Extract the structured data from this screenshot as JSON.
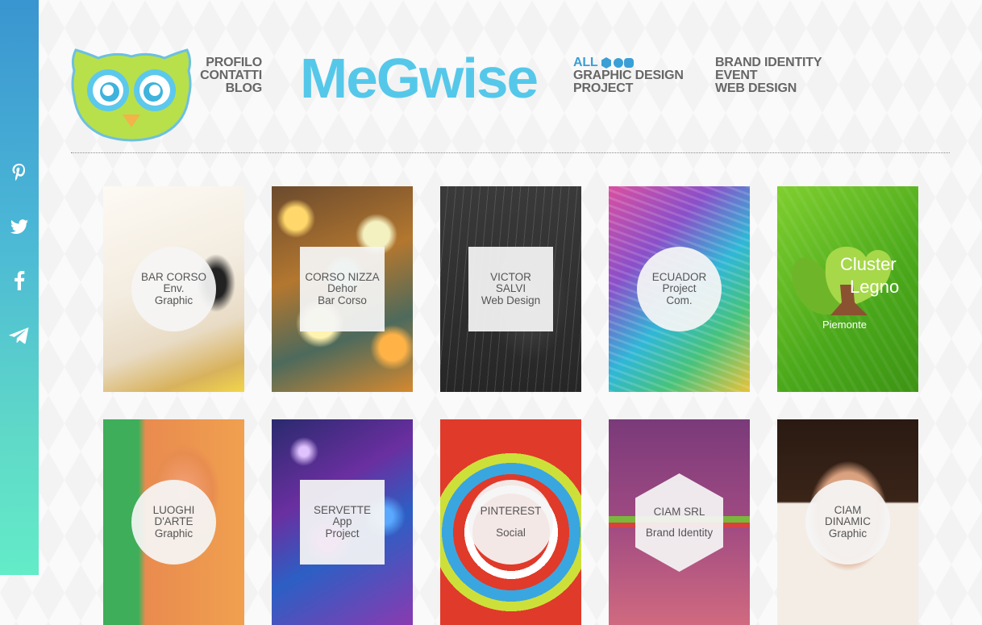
{
  "social": {
    "icons": [
      "pinterest-icon",
      "twitter-icon",
      "facebook-icon",
      "telegram-icon"
    ],
    "gradient_top": "#3a95d0",
    "gradient_bottom": "#63ecc8"
  },
  "nav": {
    "profilo": "PROFILO",
    "contatti": "CONTATTI",
    "blog": "BLOG"
  },
  "brand": {
    "name": "MeGwise",
    "color": "#55c8ea"
  },
  "filters": {
    "all": "ALL",
    "graphic_design": "GRAPHIC DESIGN",
    "project": "PROJECT",
    "brand_identity": "BRAND IDENTITY",
    "event": "EVENT",
    "web_design": "WEB DESIGN",
    "accent": "#3a9fd6"
  },
  "tiles": [
    {
      "lines": [
        "BAR CORSO",
        "Env.",
        "Graphic"
      ],
      "shape": "circle"
    },
    {
      "lines": [
        "CORSO NIZZA",
        "Dehor",
        "Bar Corso"
      ],
      "shape": "square"
    },
    {
      "lines": [
        "VICTOR",
        "SALVI",
        "Web Design"
      ],
      "shape": "square"
    },
    {
      "lines": [
        "ECUADOR",
        "Project",
        "Com."
      ],
      "shape": "circle"
    },
    {
      "lines": [
        "Cluster",
        "Legno",
        "Piemonte"
      ],
      "shape": "none"
    },
    {
      "lines": [
        "LUOGHI",
        "D'ARTE",
        "Graphic"
      ],
      "shape": "circle"
    },
    {
      "lines": [
        "SERVETTE",
        "App",
        "Project"
      ],
      "shape": "square"
    },
    {
      "lines": [
        "PINTEREST",
        "Social"
      ],
      "shape": "circle"
    },
    {
      "lines": [
        "CIAM SRL",
        "Brand Identity"
      ],
      "shape": "hexagon"
    },
    {
      "lines": [
        "CIAM",
        "DINAMIC",
        "Graphic"
      ],
      "shape": "circle"
    }
  ]
}
